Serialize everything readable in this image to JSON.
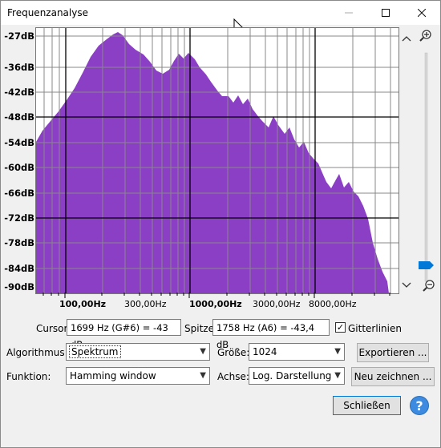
{
  "window": {
    "title": "Frequenzanalyse"
  },
  "y_labels": [
    "-27dB",
    "-36dB",
    "-42dB",
    "-48dB",
    "-54dB",
    "-60dB",
    "-66dB",
    "-72dB",
    "-78dB",
    "-84dB",
    "-90dB"
  ],
  "x_labels": [
    "100,00Hz",
    "300,00Hz",
    "1000,00Hz",
    "3000,00Hz",
    "8000,00Hz"
  ],
  "spectrum_color": "#8b3fc4",
  "cursor": {
    "label": "Cursor:",
    "value": "1699 Hz (G#6) = -43 dB"
  },
  "peak": {
    "label": "Spitze:",
    "value": "1758 Hz (A6) = -43,4 dB"
  },
  "gridlines": {
    "label": "Gitterlinien",
    "checked": true
  },
  "algorithm": {
    "label": "Algorithmus:",
    "value": "Spektrum"
  },
  "size": {
    "label": "Größe:",
    "value": "1024"
  },
  "function": {
    "label": "Funktion:",
    "value": "Hamming window"
  },
  "axis": {
    "label": "Achse:",
    "value": "Log. Darstellung"
  },
  "buttons": {
    "export": "Exportieren ...",
    "redraw": "Neu zeichnen ...",
    "close": "Schließen",
    "help": "?"
  }
}
